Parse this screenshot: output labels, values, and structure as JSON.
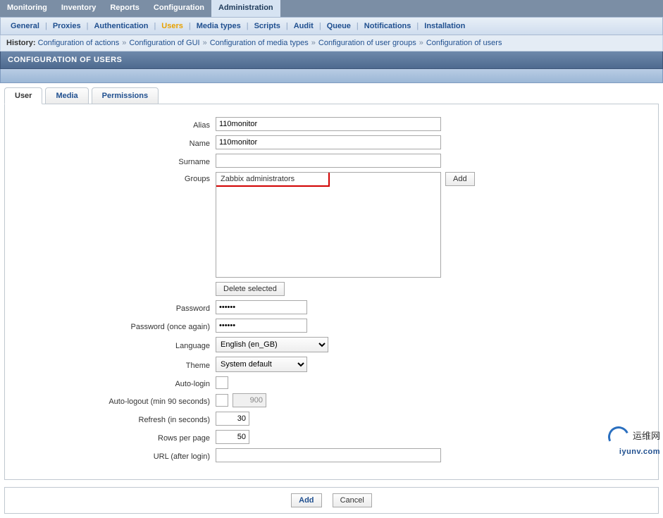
{
  "mainTabs": {
    "items": [
      "Monitoring",
      "Inventory",
      "Reports",
      "Configuration",
      "Administration"
    ],
    "active": "Administration"
  },
  "subTabs": {
    "items": [
      "General",
      "Proxies",
      "Authentication",
      "Users",
      "Media types",
      "Scripts",
      "Audit",
      "Queue",
      "Notifications",
      "Installation"
    ],
    "active": "Users"
  },
  "history": {
    "label": "History:",
    "items": [
      "Configuration of actions",
      "Configuration of GUI",
      "Configuration of media types",
      "Configuration of user groups",
      "Configuration of users"
    ]
  },
  "pageTitle": "CONFIGURATION OF USERS",
  "formTabs": {
    "items": [
      "User",
      "Media",
      "Permissions"
    ],
    "active": "User"
  },
  "labels": {
    "alias": "Alias",
    "name": "Name",
    "surname": "Surname",
    "groups": "Groups",
    "add": "Add",
    "deleteSelected": "Delete selected",
    "password": "Password",
    "password2": "Password (once again)",
    "language": "Language",
    "theme": "Theme",
    "autoLogin": "Auto-login",
    "autoLogout": "Auto-logout (min 90 seconds)",
    "refresh": "Refresh (in seconds)",
    "rowsPerPage": "Rows per page",
    "urlAfterLogin": "URL (after login)"
  },
  "values": {
    "alias": "110monitor",
    "name": "110monitor",
    "surname": "",
    "groupItem": "Zabbix administrators",
    "password": "••••••",
    "password2": "••••••",
    "language": "English (en_GB)",
    "theme": "System default",
    "autoLogout": "900",
    "refresh": "30",
    "rowsPerPage": "50",
    "urlAfterLogin": ""
  },
  "footer": {
    "add": "Add",
    "cancel": "Cancel"
  },
  "watermark": {
    "zh": "运维网",
    "url": "iyunv.com"
  }
}
